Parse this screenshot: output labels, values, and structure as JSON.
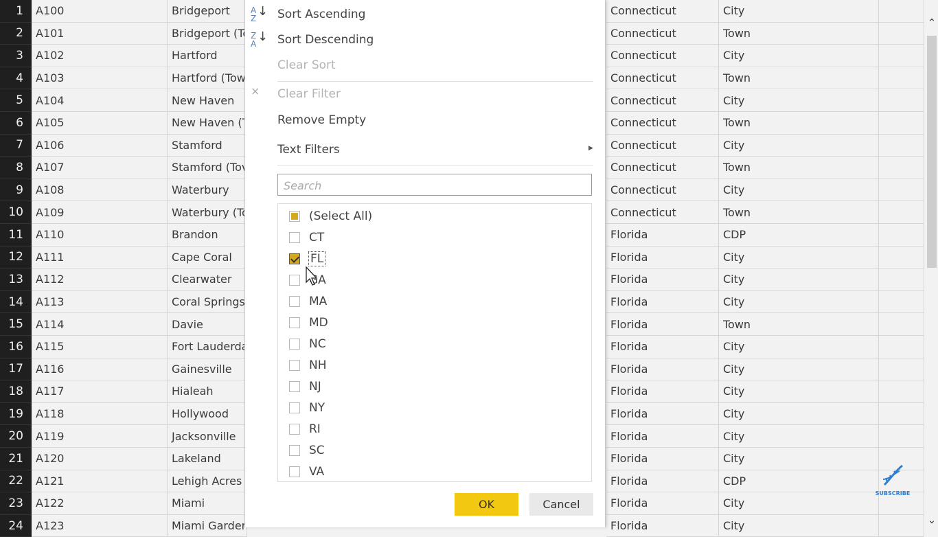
{
  "table": {
    "rows": [
      {
        "n": "1",
        "id": "A100",
        "city": "Bridgeport",
        "state": "Connecticut",
        "type": "City"
      },
      {
        "n": "2",
        "id": "A101",
        "city": "Bridgeport (To",
        "state": "Connecticut",
        "type": "Town"
      },
      {
        "n": "3",
        "id": "A102",
        "city": "Hartford",
        "state": "Connecticut",
        "type": "City"
      },
      {
        "n": "4",
        "id": "A103",
        "city": "Hartford (Tow",
        "state": "Connecticut",
        "type": "Town"
      },
      {
        "n": "5",
        "id": "A104",
        "city": "New Haven",
        "state": "Connecticut",
        "type": "City"
      },
      {
        "n": "6",
        "id": "A105",
        "city": "New Haven (T",
        "state": "Connecticut",
        "type": "Town"
      },
      {
        "n": "7",
        "id": "A106",
        "city": "Stamford",
        "state": "Connecticut",
        "type": "City"
      },
      {
        "n": "8",
        "id": "A107",
        "city": "Stamford (Tov",
        "state": "Connecticut",
        "type": "Town"
      },
      {
        "n": "9",
        "id": "A108",
        "city": "Waterbury",
        "state": "Connecticut",
        "type": "City"
      },
      {
        "n": "10",
        "id": "A109",
        "city": "Waterbury (To",
        "state": "Connecticut",
        "type": "Town"
      },
      {
        "n": "11",
        "id": "A110",
        "city": "Brandon",
        "state": "Florida",
        "type": "CDP"
      },
      {
        "n": "12",
        "id": "A111",
        "city": "Cape Coral",
        "state": "Florida",
        "type": "City"
      },
      {
        "n": "13",
        "id": "A112",
        "city": "Clearwater",
        "state": "Florida",
        "type": "City"
      },
      {
        "n": "14",
        "id": "A113",
        "city": "Coral Springs",
        "state": "Florida",
        "type": "City"
      },
      {
        "n": "15",
        "id": "A114",
        "city": "Davie",
        "state": "Florida",
        "type": "Town"
      },
      {
        "n": "16",
        "id": "A115",
        "city": "Fort Lauderda",
        "state": "Florida",
        "type": "City"
      },
      {
        "n": "17",
        "id": "A116",
        "city": "Gainesville",
        "state": "Florida",
        "type": "City"
      },
      {
        "n": "18",
        "id": "A117",
        "city": "Hialeah",
        "state": "Florida",
        "type": "City"
      },
      {
        "n": "19",
        "id": "A118",
        "city": "Hollywood",
        "state": "Florida",
        "type": "City"
      },
      {
        "n": "20",
        "id": "A119",
        "city": "Jacksonville",
        "state": "Florida",
        "type": "City"
      },
      {
        "n": "21",
        "id": "A120",
        "city": "Lakeland",
        "state": "Florida",
        "type": "City"
      },
      {
        "n": "22",
        "id": "A121",
        "city": "Lehigh Acres",
        "state": "Florida",
        "type": "CDP"
      },
      {
        "n": "23",
        "id": "A122",
        "city": "Miami",
        "state": "Florida",
        "type": "City"
      },
      {
        "n": "24",
        "id": "A123",
        "city": "Miami Garden",
        "state": "Florida",
        "type": "City"
      }
    ]
  },
  "filter_menu": {
    "sort_ascending": "Sort Ascending",
    "sort_descending": "Sort Descending",
    "clear_sort": "Clear Sort",
    "clear_filter": "Clear Filter",
    "remove_empty": "Remove Empty",
    "text_filters": "Text Filters",
    "search_placeholder": "Search",
    "options": [
      {
        "label": "(Select All)",
        "state": "partial"
      },
      {
        "label": "CT",
        "state": "unchecked"
      },
      {
        "label": "FL",
        "state": "checked"
      },
      {
        "label": "GA",
        "state": "unchecked"
      },
      {
        "label": "MA",
        "state": "unchecked"
      },
      {
        "label": "MD",
        "state": "unchecked"
      },
      {
        "label": "NC",
        "state": "unchecked"
      },
      {
        "label": "NH",
        "state": "unchecked"
      },
      {
        "label": "NJ",
        "state": "unchecked"
      },
      {
        "label": "NY",
        "state": "unchecked"
      },
      {
        "label": "RI",
        "state": "unchecked"
      },
      {
        "label": "SC",
        "state": "unchecked"
      },
      {
        "label": "VA",
        "state": "unchecked"
      }
    ],
    "ok_label": "OK",
    "cancel_label": "Cancel",
    "accent_color": "#f2c811"
  },
  "watermark": {
    "label": "SUBSCRIBE"
  }
}
